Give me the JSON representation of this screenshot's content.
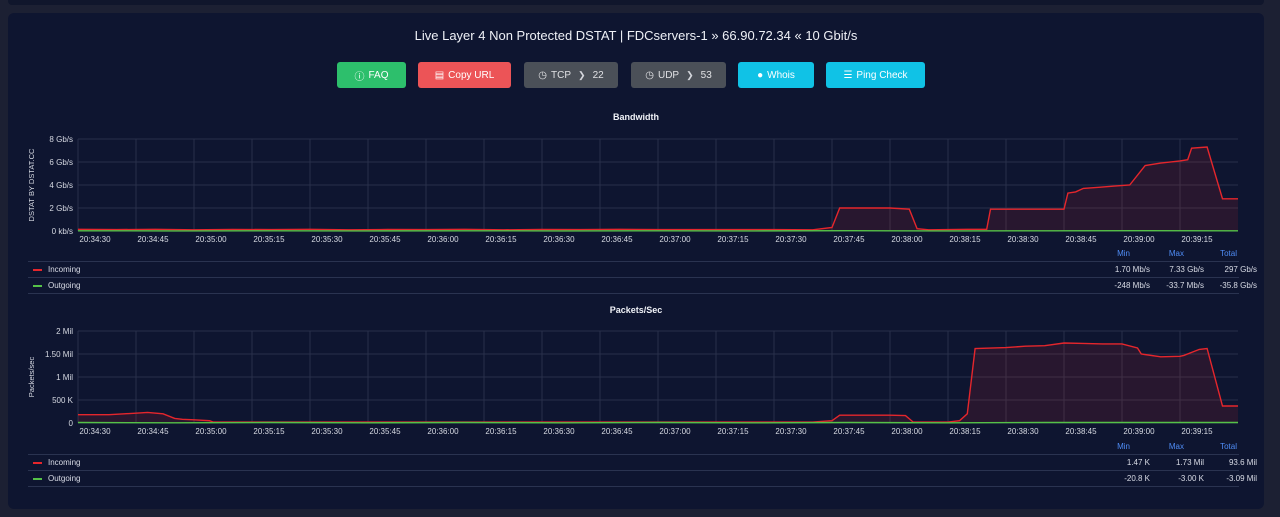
{
  "title": "Live Layer 4 Non Protected DSTAT | FDCservers-1 » 66.90.72.34 « 10 Gbit/s",
  "buttons": {
    "faq": "FAQ",
    "copy_url": "Copy URL",
    "tcp": "TCP",
    "tcp_port": "22",
    "udp": "UDP",
    "udp_port": "53",
    "whois": "Whois",
    "ping_check": "Ping Check"
  },
  "colors": {
    "incoming": "#e5262c",
    "outgoing": "#55c148",
    "accent": "#10c2e6"
  },
  "legend_headers": {
    "min": "Min",
    "max": "Max",
    "total": "Total"
  },
  "chart_data": [
    {
      "type": "line",
      "title": "Bandwidth",
      "ylabel": "DSTAT BY DSTAT.CC",
      "xlabel": "",
      "ylim": [
        0,
        8
      ],
      "yticks": [
        0,
        2,
        4,
        6,
        8
      ],
      "ytick_labels": [
        "0 kb/s",
        "2 Gb/s",
        "4 Gb/s",
        "6 Gb/s",
        "8 Gb/s"
      ],
      "xlim": [
        0,
        300
      ],
      "xticks": [
        0,
        15,
        30,
        45,
        60,
        75,
        90,
        105,
        120,
        135,
        150,
        165,
        180,
        195,
        210,
        225,
        240,
        255,
        270,
        285
      ],
      "xtick_labels": [
        "20:34:30",
        "20:34:45",
        "20:35:00",
        "20:35:15",
        "20:35:30",
        "20:35:45",
        "20:36:00",
        "20:36:15",
        "20:36:30",
        "20:36:45",
        "20:37:00",
        "20:37:15",
        "20:37:30",
        "20:37:45",
        "20:38:00",
        "20:38:15",
        "20:38:30",
        "20:38:45",
        "20:39:00",
        "20:39:15"
      ],
      "grid": true,
      "series": [
        {
          "name": "Incoming",
          "color": "#e5262c",
          "x": [
            0,
            10,
            20,
            30,
            40,
            50,
            60,
            70,
            80,
            90,
            100,
            110,
            120,
            130,
            140,
            150,
            160,
            170,
            180,
            190,
            195,
            197,
            200,
            210,
            215,
            217,
            220,
            230,
            235,
            236,
            240,
            250,
            255,
            256,
            258,
            260,
            264,
            268,
            272,
            276,
            280,
            285,
            287,
            288,
            292,
            296,
            300
          ],
          "values": [
            0.15,
            0.12,
            0.15,
            0.1,
            0.14,
            0.12,
            0.15,
            0.1,
            0.13,
            0.12,
            0.15,
            0.1,
            0.13,
            0.12,
            0.15,
            0.12,
            0.12,
            0.12,
            0.12,
            0.1,
            0.3,
            2.0,
            2.0,
            2.0,
            1.9,
            0.2,
            0.1,
            0.15,
            0.15,
            1.9,
            1.9,
            1.9,
            1.9,
            3.3,
            3.4,
            3.7,
            3.8,
            3.9,
            4.0,
            5.7,
            5.9,
            6.1,
            6.2,
            7.2,
            7.3,
            2.8,
            2.8
          ]
        },
        {
          "name": "Outgoing",
          "color": "#55c148",
          "x": [
            0,
            25,
            50,
            75,
            100,
            125,
            150,
            175,
            200,
            225,
            250,
            275,
            300
          ],
          "values": [
            0.02,
            0.01,
            0.02,
            0.01,
            0.02,
            0.01,
            0.02,
            0.01,
            0.03,
            0.01,
            0.02,
            0.03,
            0.02
          ]
        }
      ],
      "legend": [
        {
          "name": "Incoming",
          "min": "1.70 Mb/s",
          "max": "7.33 Gb/s",
          "total": "297 Gb/s"
        },
        {
          "name": "Outgoing",
          "min": "-248 Mb/s",
          "max": "-33.7 Mb/s",
          "total": "-35.8 Gb/s"
        }
      ]
    },
    {
      "type": "line",
      "title": "Packets/Sec",
      "ylabel": "Packets/sec",
      "xlabel": "",
      "ylim": [
        0,
        2
      ],
      "yticks": [
        0,
        0.5,
        1,
        1.5,
        2
      ],
      "ytick_labels": [
        "0",
        "500 K",
        "1 Mil",
        "1.50 Mil",
        "2 Mil"
      ],
      "xlim": [
        0,
        300
      ],
      "xticks": [
        0,
        15,
        30,
        45,
        60,
        75,
        90,
        105,
        120,
        135,
        150,
        165,
        180,
        195,
        210,
        225,
        240,
        255,
        270,
        285
      ],
      "xtick_labels": [
        "20:34:30",
        "20:34:45",
        "20:35:00",
        "20:35:15",
        "20:35:30",
        "20:35:45",
        "20:36:00",
        "20:36:15",
        "20:36:30",
        "20:36:45",
        "20:37:00",
        "20:37:15",
        "20:37:30",
        "20:37:45",
        "20:38:00",
        "20:38:15",
        "20:38:30",
        "20:38:45",
        "20:39:00",
        "20:39:15"
      ],
      "grid": true,
      "series": [
        {
          "name": "Incoming",
          "color": "#e5262c",
          "x": [
            0,
            8,
            12,
            16,
            18,
            22,
            25,
            27,
            30,
            34,
            35,
            40,
            60,
            80,
            100,
            120,
            140,
            160,
            180,
            190,
            195,
            197,
            200,
            210,
            214,
            216,
            225,
            228,
            230,
            232,
            240,
            245,
            250,
            255,
            260,
            265,
            270,
            274,
            275,
            280,
            285,
            286,
            290,
            292,
            296,
            300
          ],
          "values": [
            0.18,
            0.18,
            0.2,
            0.22,
            0.23,
            0.2,
            0.1,
            0.08,
            0.07,
            0.05,
            0.02,
            0.02,
            0.02,
            0.02,
            0.02,
            0.02,
            0.02,
            0.02,
            0.02,
            0.02,
            0.05,
            0.17,
            0.17,
            0.17,
            0.16,
            0.02,
            0.02,
            0.05,
            0.2,
            1.62,
            1.64,
            1.67,
            1.68,
            1.74,
            1.73,
            1.72,
            1.72,
            1.63,
            1.5,
            1.44,
            1.45,
            1.47,
            1.6,
            1.62,
            0.37,
            0.37
          ]
        },
        {
          "name": "Outgoing",
          "color": "#55c148",
          "x": [
            0,
            25,
            50,
            75,
            100,
            125,
            150,
            175,
            200,
            225,
            250,
            275,
            300
          ],
          "values": [
            0.01,
            0.005,
            0.01,
            0.005,
            0.01,
            0.005,
            0.01,
            0.005,
            0.01,
            0.005,
            0.01,
            0.01,
            0.01
          ]
        }
      ],
      "legend": [
        {
          "name": "Incoming",
          "min": "1.47 K",
          "max": "1.73 Mil",
          "total": "93.6 Mil"
        },
        {
          "name": "Outgoing",
          "min": "-20.8 K",
          "max": "-3.00 K",
          "total": "-3.09 Mil"
        }
      ]
    }
  ]
}
